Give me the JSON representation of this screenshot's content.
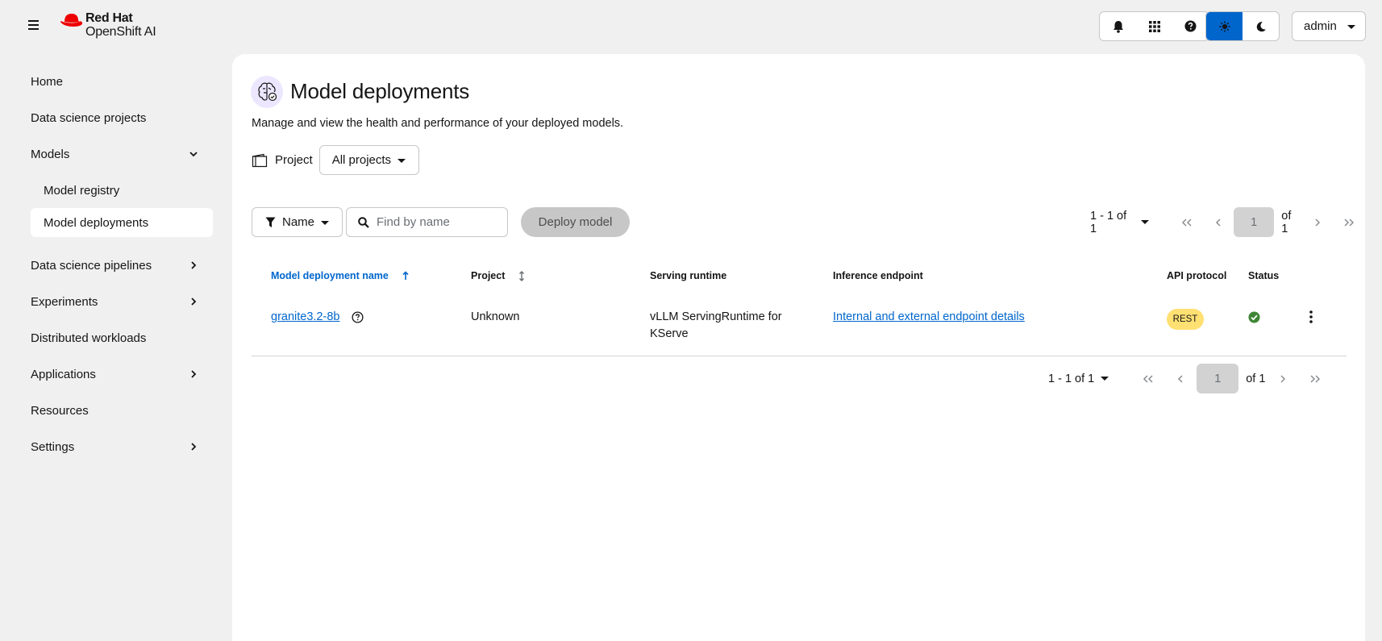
{
  "masthead": {
    "brand_line1": "Red Hat",
    "brand_line2": "OpenShift AI",
    "user": "admin",
    "icons": [
      "hamburger-icon",
      "bell-icon",
      "app-grid-icon",
      "help-icon",
      "sun-icon",
      "moon-icon"
    ]
  },
  "sidebar": {
    "items": [
      {
        "label": "Home"
      },
      {
        "label": "Data science projects"
      },
      {
        "label": "Models",
        "expanded": true
      },
      {
        "label": "Model registry"
      },
      {
        "label": "Model deployments",
        "active": true
      },
      {
        "label": "Data science pipelines"
      },
      {
        "label": "Experiments"
      },
      {
        "label": "Distributed workloads"
      },
      {
        "label": "Applications"
      },
      {
        "label": "Resources"
      },
      {
        "label": "Settings"
      }
    ]
  },
  "page": {
    "title": "Model deployments",
    "description": "Manage and view the health and performance of your deployed models.",
    "project_label": "Project",
    "project_value": "All projects"
  },
  "toolbar": {
    "filter_label": "Name",
    "search_placeholder": "Find by name",
    "deploy_label": "Deploy model"
  },
  "pagination": {
    "range": "1 - 1 of 1",
    "page": "1",
    "of": "of 1"
  },
  "table": {
    "columns": [
      "Model deployment name",
      "Project",
      "Serving runtime",
      "Inference endpoint",
      "API protocol",
      "Status"
    ],
    "rows": [
      {
        "name": "granite3.2-8b",
        "project": "Unknown",
        "runtime_line1": "vLLM ServingRuntime for",
        "runtime_line2": "KServe",
        "endpoint": "Internal and external endpoint details",
        "protocol": "REST",
        "status": "success"
      }
    ]
  },
  "colors": {
    "accent": "#0066cc",
    "badge": "#ffe072",
    "status_ok": "#3e8635"
  }
}
